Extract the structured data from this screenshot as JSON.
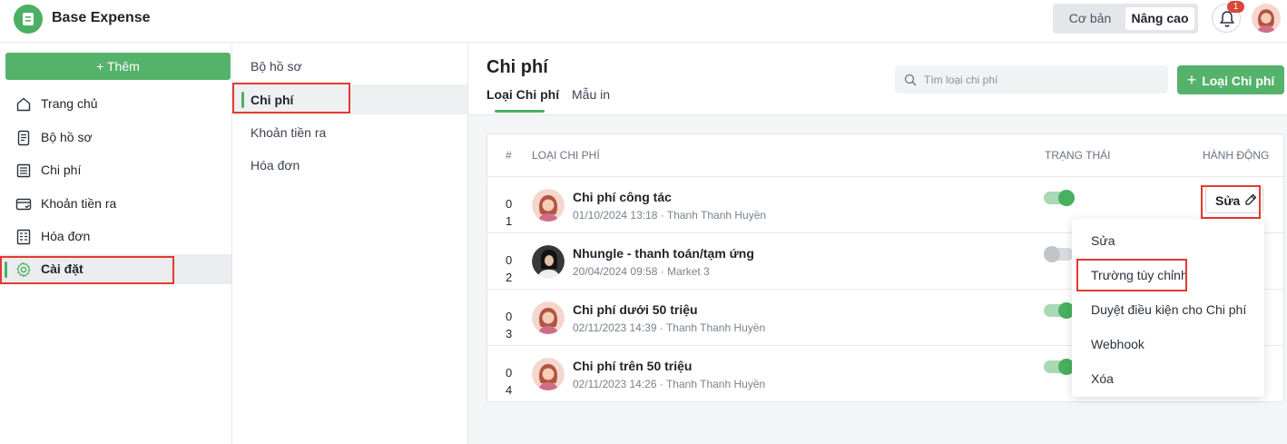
{
  "app": {
    "title": "Base Expense"
  },
  "header": {
    "mode_basic": "Cơ bản",
    "mode_advanced": "Nâng cao",
    "notification_count": "1"
  },
  "sidebar": {
    "add_label": "+ Thêm",
    "items": [
      {
        "label": "Trang chủ",
        "icon": "home-icon"
      },
      {
        "label": "Bộ hồ sơ",
        "icon": "document-icon"
      },
      {
        "label": "Chi phí",
        "icon": "list-icon"
      },
      {
        "label": "Khoản tiền ra",
        "icon": "wallet-icon"
      },
      {
        "label": "Hóa đơn",
        "icon": "invoice-icon"
      },
      {
        "label": "Cài đặt",
        "icon": "gear-icon",
        "active": true
      }
    ]
  },
  "subnav": {
    "items": [
      {
        "label": "Bộ hồ sơ"
      },
      {
        "label": "Chi phí",
        "active": true
      },
      {
        "label": "Khoản tiền ra"
      },
      {
        "label": "Hóa đơn"
      }
    ]
  },
  "main": {
    "title": "Chi phí",
    "tabs": [
      {
        "label": "Loại Chi phí",
        "active": true
      },
      {
        "label": "Mẫu in"
      }
    ],
    "search_placeholder": "Tìm loại chi phí",
    "add_button": "Loại Chi phí"
  },
  "table": {
    "headers": {
      "num": "#",
      "type": "Loại chi phí",
      "status": "Trạng thái",
      "action": "Hành động"
    },
    "rows": [
      {
        "num": "01",
        "name": "Chi phí công tác",
        "meta": "01/10/2024 13:18 · Thanh Thanh Huyền",
        "enabled": true,
        "avatar": "female-avatar"
      },
      {
        "num": "02",
        "name": "Nhungle - thanh toán/tạm ứng",
        "meta": "20/04/2024 09:58 · Market 3",
        "enabled": false,
        "avatar": "photo-avatar"
      },
      {
        "num": "03",
        "name": "Chi phí dưới 50 triệu",
        "meta": "02/11/2023 14:39 · Thanh Thanh Huyền",
        "enabled": true,
        "avatar": "female-avatar"
      },
      {
        "num": "04",
        "name": "Chi phí trên 50 triệu",
        "meta": "02/11/2023 14:26 · Thanh Thanh Huyền",
        "enabled": true,
        "avatar": "female-avatar"
      }
    ],
    "edit_label": "Sửa"
  },
  "dropdown": {
    "items": [
      "Sửa",
      "Trường tùy chỉnh",
      "Duyệt điều kiện cho Chi phí",
      "Webhook",
      "Xóa"
    ]
  },
  "colors": {
    "accent": "#55b26a",
    "highlight": "#e23a2f"
  }
}
